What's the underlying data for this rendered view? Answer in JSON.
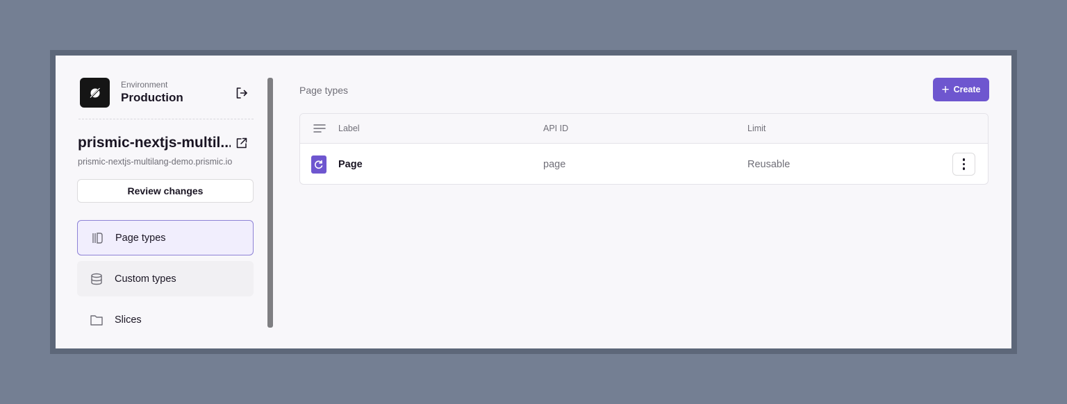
{
  "environment": {
    "label": "Environment",
    "name": "Production"
  },
  "repository": {
    "title": "prismic-nextjs-multil...",
    "url": "prismic-nextjs-multilang-demo.prismic.io"
  },
  "sidebar": {
    "review_label": "Review changes",
    "items": [
      {
        "label": "Page types",
        "icon": "page-types-icon",
        "active": true
      },
      {
        "label": "Custom types",
        "icon": "database-icon",
        "active": false
      },
      {
        "label": "Slices",
        "icon": "folder-icon",
        "active": false
      }
    ]
  },
  "main": {
    "heading": "Page types",
    "create_label": "Create",
    "table": {
      "columns": [
        "Label",
        "API ID",
        "Limit"
      ],
      "rows": [
        {
          "label": "Page",
          "api_id": "page",
          "limit": "Reusable"
        }
      ]
    }
  },
  "colors": {
    "accent": "#6e56cf",
    "active_bg": "#f1eefd",
    "backdrop": "#747f93"
  }
}
